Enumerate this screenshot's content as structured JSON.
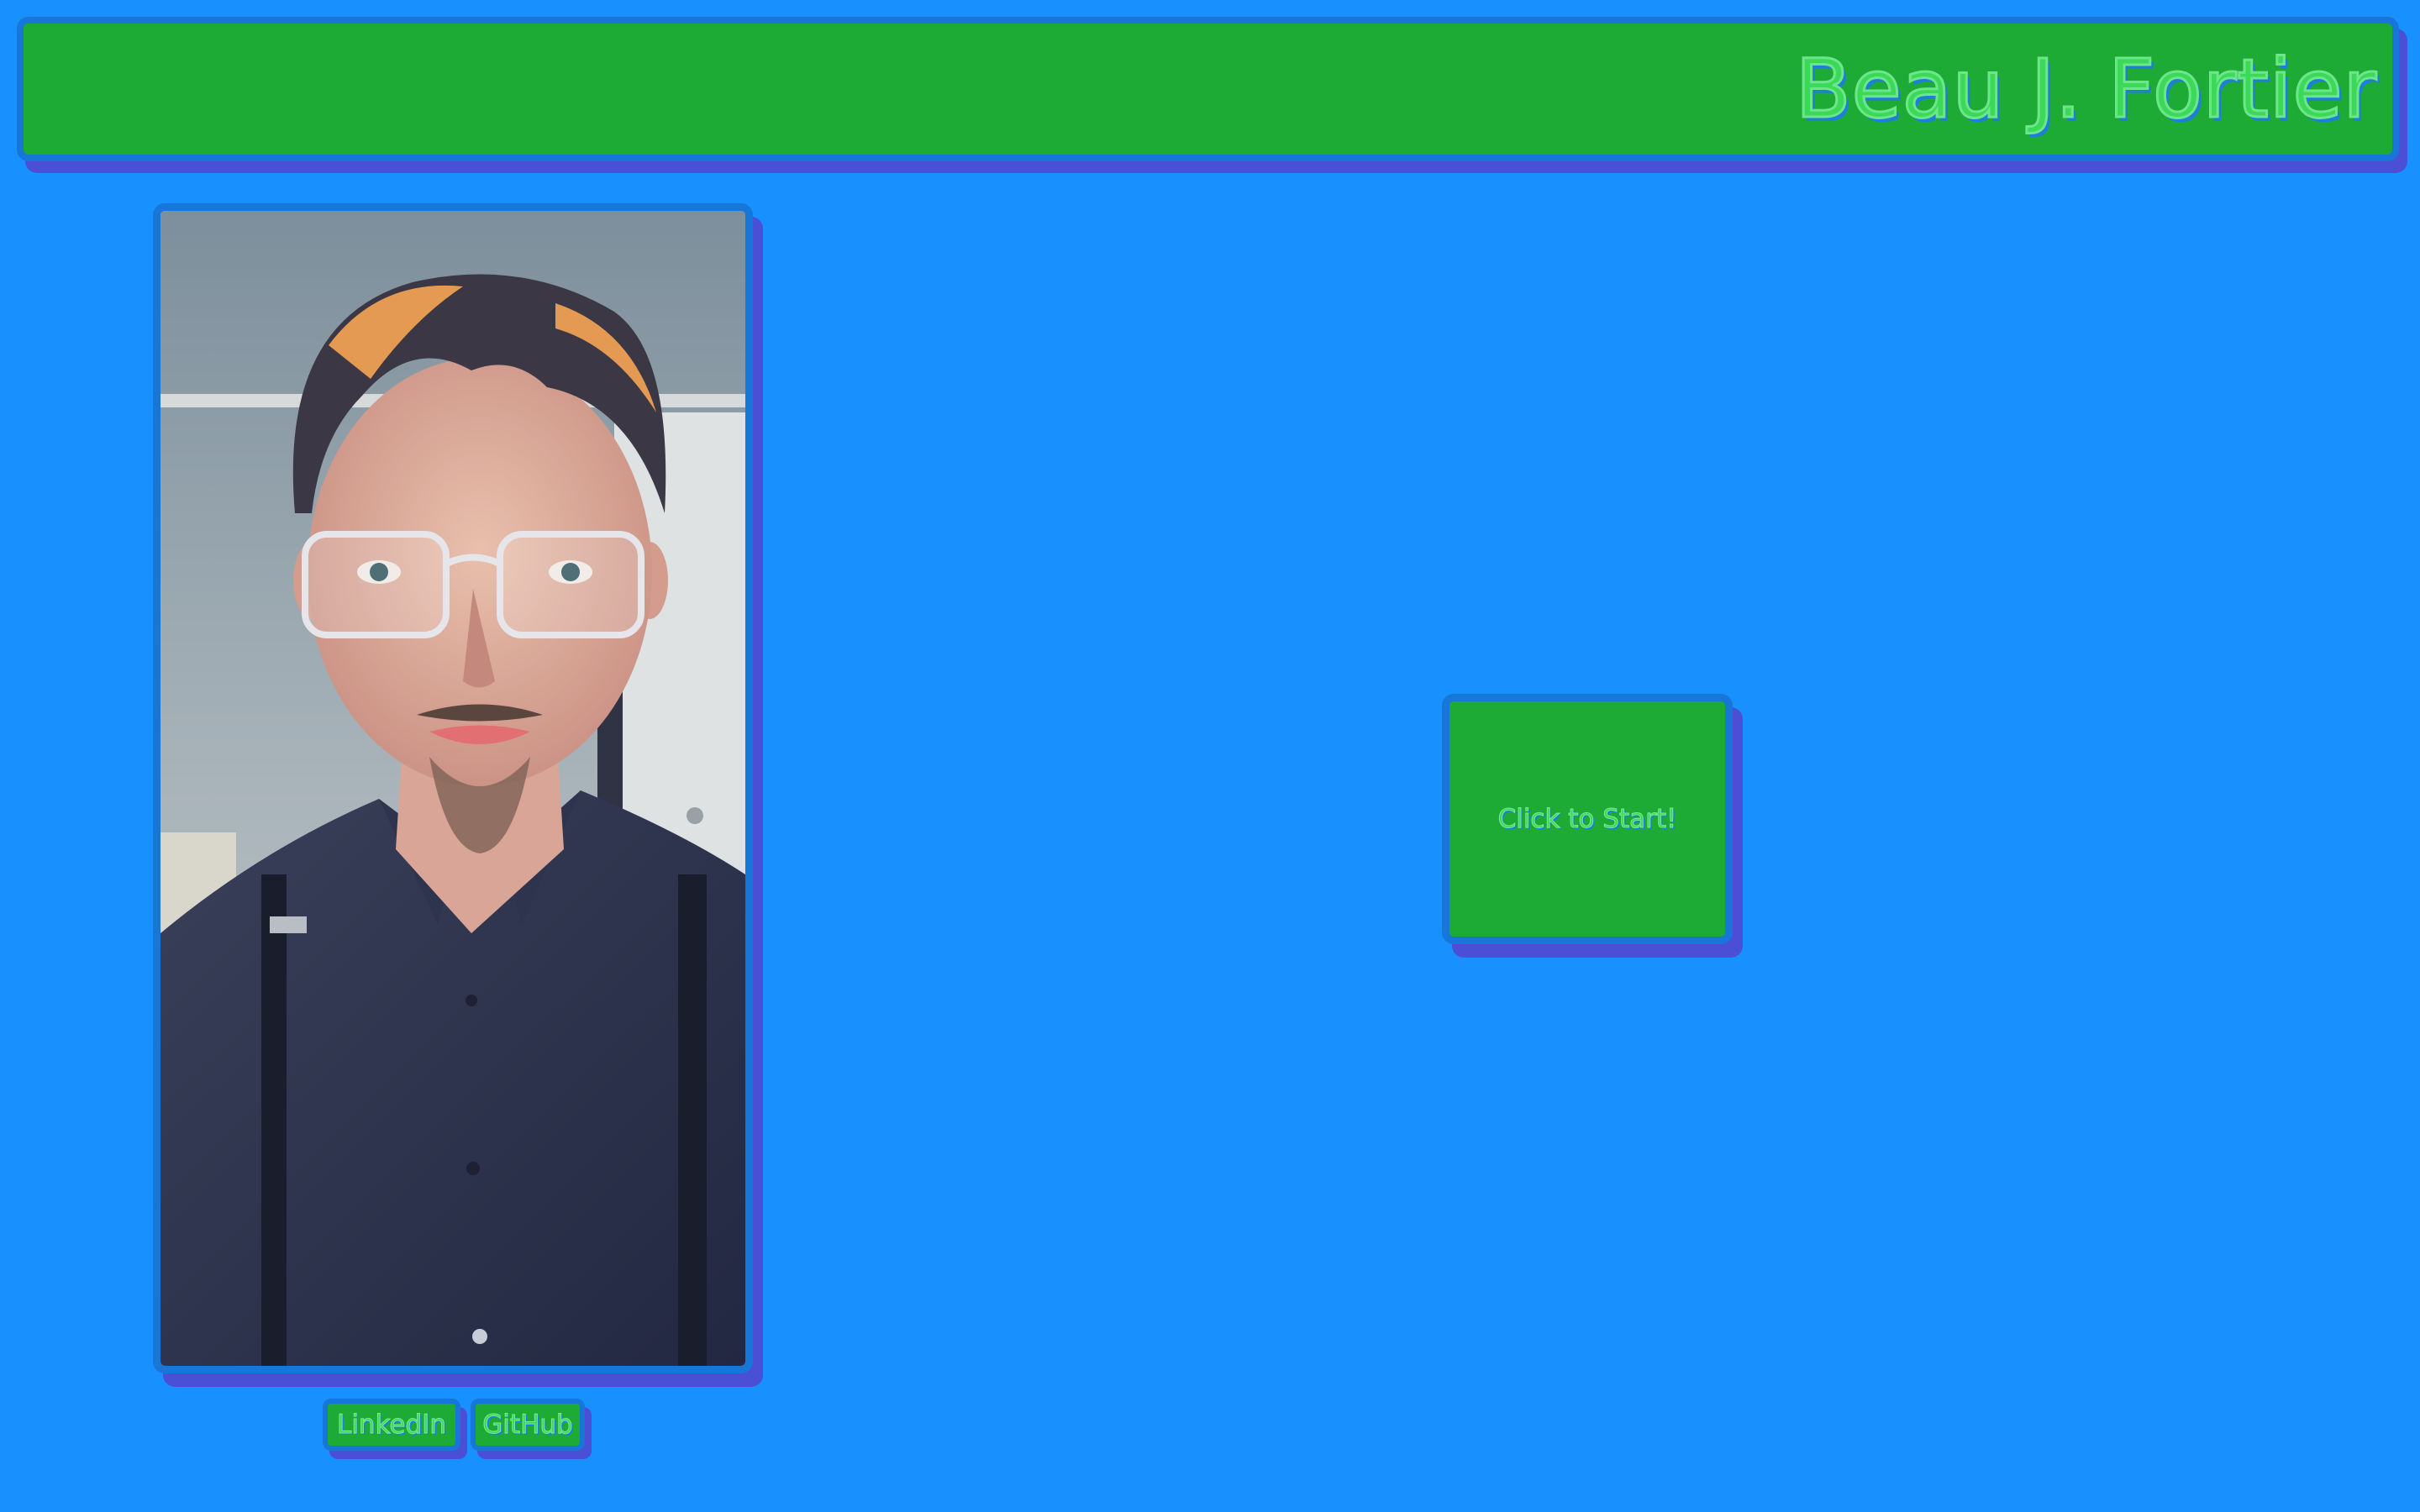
{
  "header": {
    "title": "Beau J. Fortier"
  },
  "profile": {
    "photo_icon": "portrait-photo"
  },
  "links": {
    "linkedin_label": "LinkedIn",
    "github_label": "GitHub"
  },
  "start": {
    "label": "Click to Start!"
  },
  "colors": {
    "background": "#1890fd",
    "panel": "#1eab35",
    "border": "#1677d9",
    "shadow": "#4a4fd6",
    "text": "#3ad957"
  }
}
